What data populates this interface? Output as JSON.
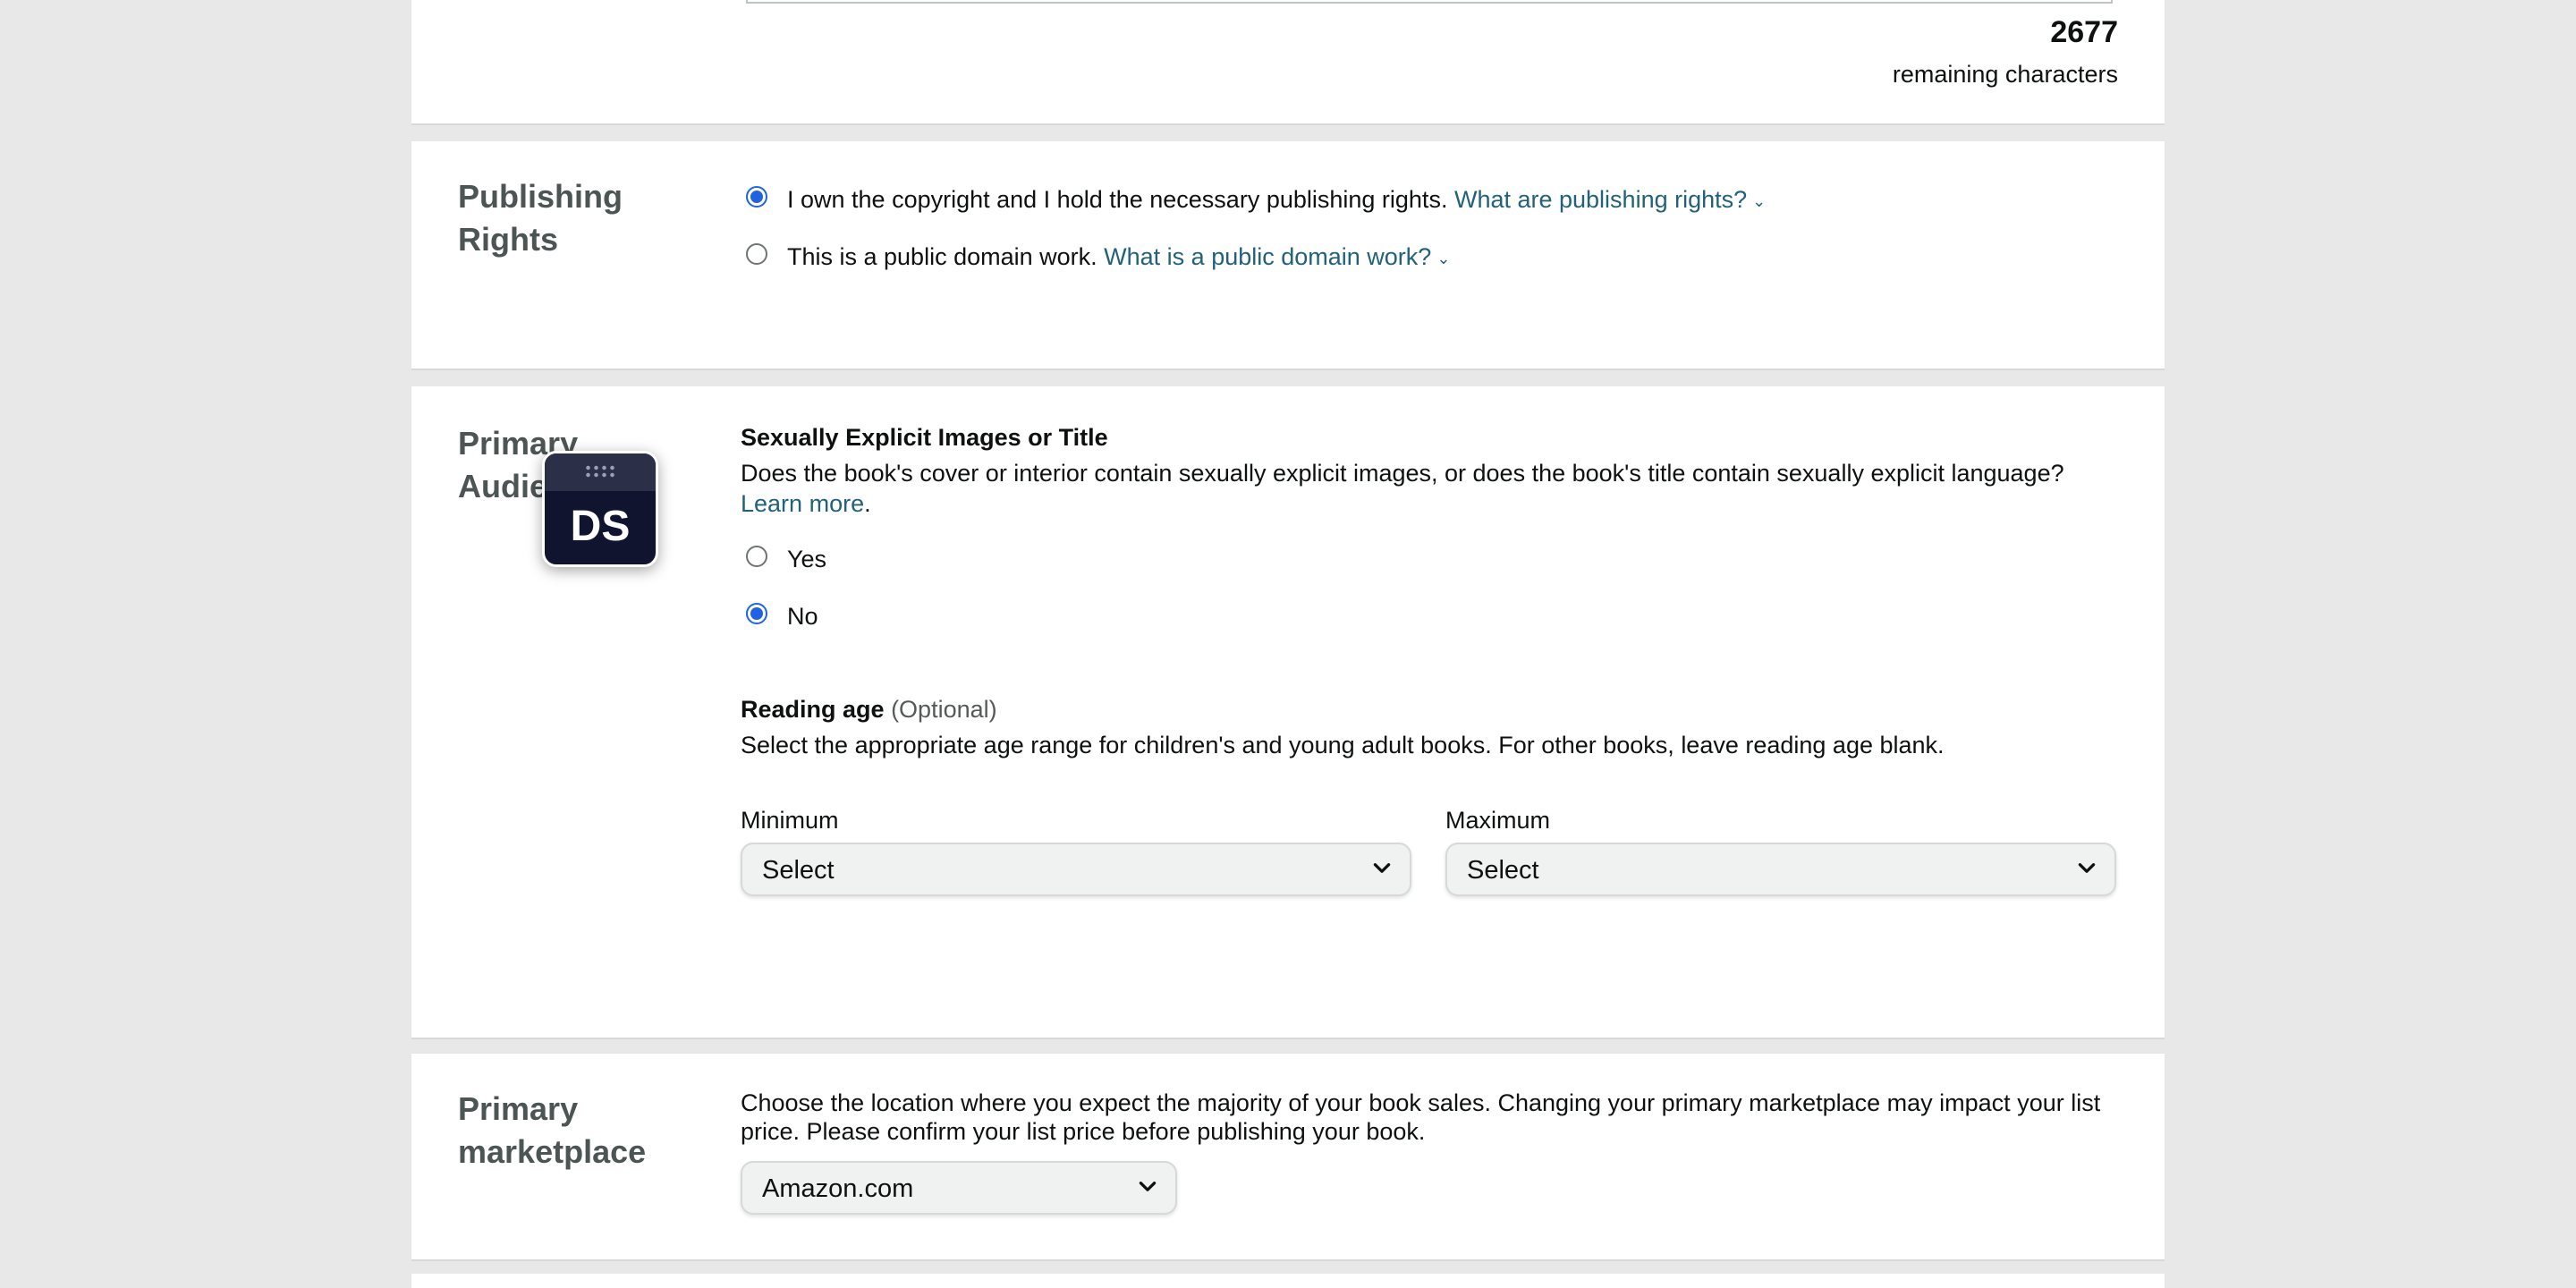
{
  "description_counter": {
    "count": "2677",
    "label": "remaining characters"
  },
  "publishing_rights": {
    "title": "Publishing Rights",
    "options": [
      {
        "label": "I own the copyright and I hold the necessary publishing rights.",
        "help_link": "What are publishing rights?",
        "selected": true
      },
      {
        "label": "This is a public domain work.",
        "help_link": "What is a public domain work?",
        "selected": false
      }
    ]
  },
  "primary_audience": {
    "title": "Primary Audience",
    "explicit": {
      "heading": "Sexually Explicit Images or Title",
      "question": "Does the book's cover or interior contain sexually explicit images, or does the book's title contain sexually explicit language?",
      "learn_more_1": "Learn",
      "learn_more_2": "more",
      "period": ".",
      "options": [
        {
          "label": "Yes",
          "selected": false
        },
        {
          "label": "No",
          "selected": true
        }
      ]
    },
    "reading_age": {
      "heading": "Reading age",
      "optional": "(Optional)",
      "help": "Select the appropriate age range for children's and young adult books. For other books, leave reading age blank.",
      "minimum_label": "Minimum",
      "minimum_value": "Select",
      "maximum_label": "Maximum",
      "maximum_value": "Select"
    }
  },
  "primary_marketplace": {
    "title_line1": "Primary",
    "title_line2": "marketplace",
    "help_line1": "Choose the location where you expect the majority of your book sales. Changing your primary marketplace may impact your list",
    "help_line2": "price. Please confirm your list price before publishing your book.",
    "value": "Amazon.com"
  },
  "overlay_badge": {
    "label": "DS",
    "icon": "drag-handle-icon"
  },
  "colors": {
    "accent": "#2162e0",
    "link": "#21617a",
    "background": "#e8e8e8"
  }
}
